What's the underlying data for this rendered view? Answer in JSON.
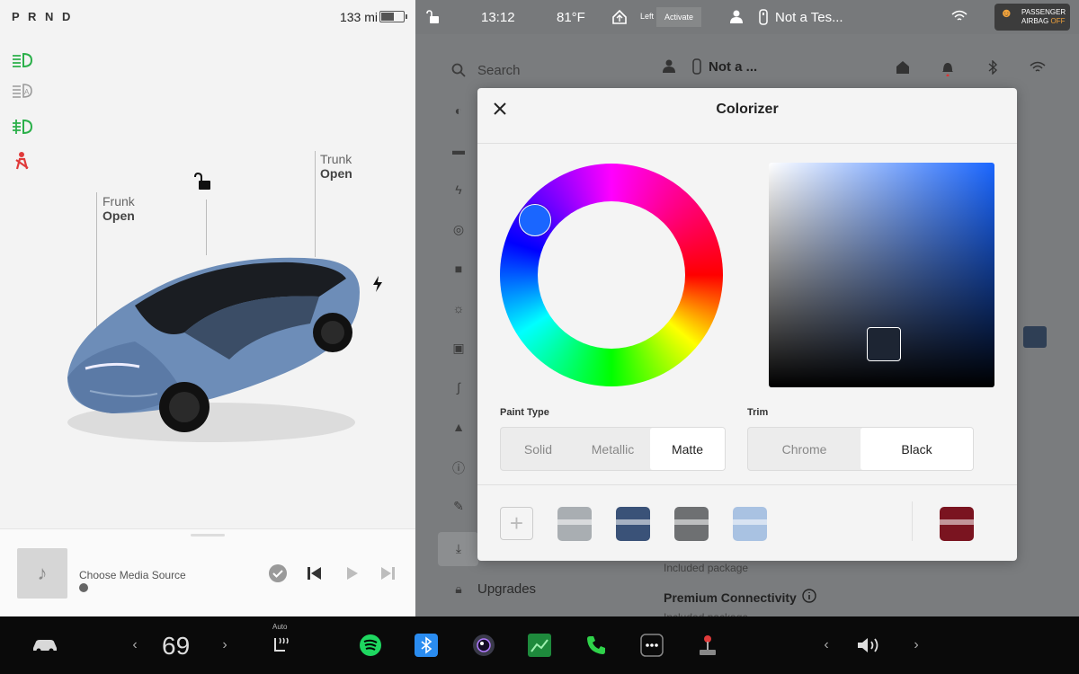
{
  "left_panel": {
    "gear": "P R N D",
    "range": "133 mi",
    "frunk": {
      "title": "Frunk",
      "state": "Open"
    },
    "trunk": {
      "title": "Trunk",
      "state": "Open"
    }
  },
  "media": {
    "source_label": "Choose Media Source"
  },
  "status_bar": {
    "time": "13:12",
    "temperature": "81°F",
    "homelink_label": "Left",
    "activate_label": "Activate",
    "profile": "Not a Tes...",
    "airbag": {
      "line1": "PASSENGER",
      "line2_prefix": "AIRBAG",
      "line2_state": "OFF"
    }
  },
  "background_settings": {
    "search_label": "Search",
    "profile": "Not a ...",
    "upgrades_label": "Upgrades",
    "included_package": "Included package",
    "premium_connectivity": "Premium Connectivity",
    "included_package_2": "Included package"
  },
  "modal": {
    "title": "Colorizer",
    "hue_color": "#1a66ff",
    "selected_color": "#1d2533",
    "paint_type": {
      "label": "Paint Type",
      "options": [
        "Solid",
        "Metallic",
        "Matte"
      ],
      "selected": "Matte"
    },
    "trim": {
      "label": "Trim",
      "options": [
        "Chrome",
        "Black"
      ],
      "selected": "Black"
    },
    "swatches": [
      {
        "name": "silver",
        "color": "#a9aeb2"
      },
      {
        "name": "dark-blue",
        "color": "#3a5278"
      },
      {
        "name": "gray",
        "color": "#6e7072"
      },
      {
        "name": "light-blue",
        "color": "#a9c2e2"
      },
      {
        "name": "red",
        "color": "#7a1420"
      }
    ]
  },
  "dock": {
    "temperature": "69",
    "seat_heat_mode": "Auto"
  }
}
